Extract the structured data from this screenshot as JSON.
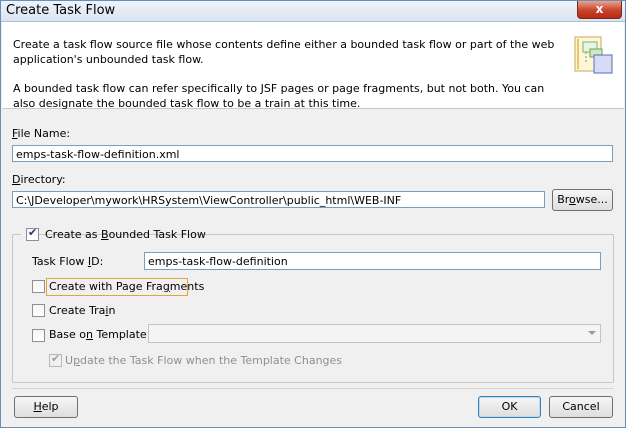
{
  "window": {
    "title": "Create Task Flow",
    "close_glyph": "x"
  },
  "header": {
    "description_1": "Create a task flow source file whose contents define either a bounded task flow or part of the web application's unbounded task flow.",
    "description_2": "A bounded task flow can refer specifically to JSF pages or page fragments, but not both.  You can also designate the bounded task flow to be a train at this time.",
    "icon": "task-flow-wizard-icon"
  },
  "file_name": {
    "label_mnemonic": "F",
    "label_rest": "ile Name:",
    "value": "emps-task-flow-definition.xml"
  },
  "directory": {
    "label_mnemonic": "D",
    "label_rest": "irectory:",
    "value": "C:\\JDeveloper\\mywork\\HRSystem\\ViewController\\public_html\\WEB-INF",
    "browse_pre": "Br",
    "browse_mnemonic": "o",
    "browse_post": "wse..."
  },
  "bounded": {
    "checked": true,
    "label_pre": "Create as ",
    "label_mnemonic": "B",
    "label_post": "ounded Task Flow",
    "task_flow_id_pre": "Task Flow ",
    "task_flow_id_mnemonic": "I",
    "task_flow_id_post": "D:",
    "task_flow_id_value": "emps-task-flow-definition",
    "page_fragments_pre": "Create with Page Fra",
    "page_fragments_mnemonic": "g",
    "page_fragments_post": "ments",
    "create_train_pre": "Create Tra",
    "create_train_mnemonic": "i",
    "create_train_post": "n",
    "base_template_pre": "Base o",
    "base_template_mnemonic": "n",
    "base_template_post": " Template:",
    "update_pre": "U",
    "update_mnemonic": "p",
    "update_post": "date the Task Flow when the Template Changes"
  },
  "footer": {
    "help_mnemonic": "H",
    "help_rest": "elp",
    "ok": "OK",
    "cancel": "Cancel"
  },
  "colors": {
    "window_bg": "#f0f0f0",
    "focus_border": "#e5a43a",
    "default_button_border": "#3c7fb1"
  }
}
